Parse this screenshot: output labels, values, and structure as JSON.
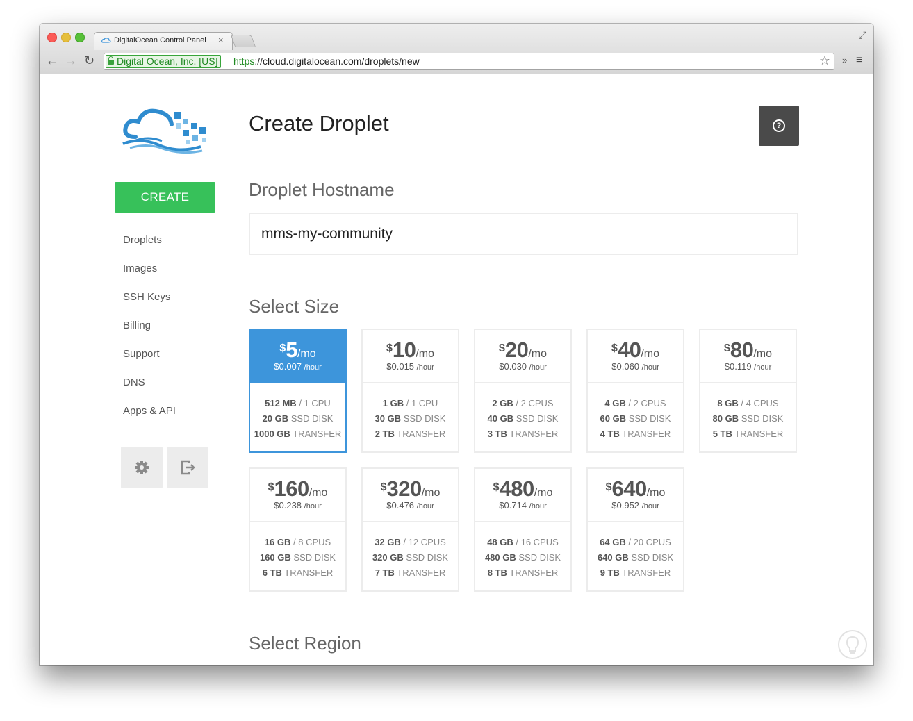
{
  "browser": {
    "tab_title": "DigitalOcean Control Panel",
    "tab_close": "×",
    "back_icon": "←",
    "forward_icon": "→",
    "reload_icon": "↻",
    "ev_label": "Digital Ocean, Inc. [US]",
    "url_scheme": "https",
    "url_rest": "://cloud.digitalocean.com/droplets/new",
    "star_icon": "☆",
    "extensions_icon": "»",
    "menu_icon": "≡",
    "fullscreen_icon": "⤢"
  },
  "sidebar": {
    "create_label": "CREATE",
    "items": [
      "Droplets",
      "Images",
      "SSH Keys",
      "Billing",
      "Support",
      "DNS",
      "Apps & API"
    ]
  },
  "main": {
    "title": "Create Droplet",
    "help_icon": "?",
    "hostname_heading": "Droplet Hostname",
    "hostname_value": "mms-my-community",
    "size_heading": "Select Size",
    "region_heading": "Select Region"
  },
  "sizes": [
    {
      "cur": "$",
      "amount": "5",
      "per": "/mo",
      "hourly": "$0.007",
      "hourly_unit": "/hour",
      "mem": "512 MB",
      "cpu": "/ 1 CPU",
      "disk": "20 GB",
      "disk_unit": "SSD DISK",
      "transfer": "1000 GB",
      "transfer_unit": "TRANSFER"
    },
    {
      "cur": "$",
      "amount": "10",
      "per": "/mo",
      "hourly": "$0.015",
      "hourly_unit": "/hour",
      "mem": "1 GB",
      "cpu": "/ 1 CPU",
      "disk": "30 GB",
      "disk_unit": "SSD DISK",
      "transfer": "2 TB",
      "transfer_unit": "TRANSFER"
    },
    {
      "cur": "$",
      "amount": "20",
      "per": "/mo",
      "hourly": "$0.030",
      "hourly_unit": "/hour",
      "mem": "2 GB",
      "cpu": "/ 2 CPUS",
      "disk": "40 GB",
      "disk_unit": "SSD DISK",
      "transfer": "3 TB",
      "transfer_unit": "TRANSFER"
    },
    {
      "cur": "$",
      "amount": "40",
      "per": "/mo",
      "hourly": "$0.060",
      "hourly_unit": "/hour",
      "mem": "4 GB",
      "cpu": "/ 2 CPUS",
      "disk": "60 GB",
      "disk_unit": "SSD DISK",
      "transfer": "4 TB",
      "transfer_unit": "TRANSFER"
    },
    {
      "cur": "$",
      "amount": "80",
      "per": "/mo",
      "hourly": "$0.119",
      "hourly_unit": "/hour",
      "mem": "8 GB",
      "cpu": "/ 4 CPUS",
      "disk": "80 GB",
      "disk_unit": "SSD DISK",
      "transfer": "5 TB",
      "transfer_unit": "TRANSFER"
    },
    {
      "cur": "$",
      "amount": "160",
      "per": "/mo",
      "hourly": "$0.238",
      "hourly_unit": "/hour",
      "mem": "16 GB",
      "cpu": "/ 8 CPUS",
      "disk": "160 GB",
      "disk_unit": "SSD DISK",
      "transfer": "6 TB",
      "transfer_unit": "TRANSFER"
    },
    {
      "cur": "$",
      "amount": "320",
      "per": "/mo",
      "hourly": "$0.476",
      "hourly_unit": "/hour",
      "mem": "32 GB",
      "cpu": "/ 12 CPUS",
      "disk": "320 GB",
      "disk_unit": "SSD DISK",
      "transfer": "7 TB",
      "transfer_unit": "TRANSFER"
    },
    {
      "cur": "$",
      "amount": "480",
      "per": "/mo",
      "hourly": "$0.714",
      "hourly_unit": "/hour",
      "mem": "48 GB",
      "cpu": "/ 16 CPUS",
      "disk": "480 GB",
      "disk_unit": "SSD DISK",
      "transfer": "8 TB",
      "transfer_unit": "TRANSFER"
    },
    {
      "cur": "$",
      "amount": "640",
      "per": "/mo",
      "hourly": "$0.952",
      "hourly_unit": "/hour",
      "mem": "64 GB",
      "cpu": "/ 20 CPUS",
      "disk": "640 GB",
      "disk_unit": "SSD DISK",
      "transfer": "9 TB",
      "transfer_unit": "TRANSFER"
    }
  ],
  "colors": {
    "create_green": "#37c15a",
    "selected_blue": "#3d95db",
    "help_dark": "#4a4a4a",
    "secure_green": "#1f8a21"
  },
  "icons": {
    "settings": "gear-icon",
    "logout": "logout-icon",
    "help": "question-circle-icon",
    "tips": "lightbulb-icon",
    "logo": "digitalocean-logo"
  }
}
